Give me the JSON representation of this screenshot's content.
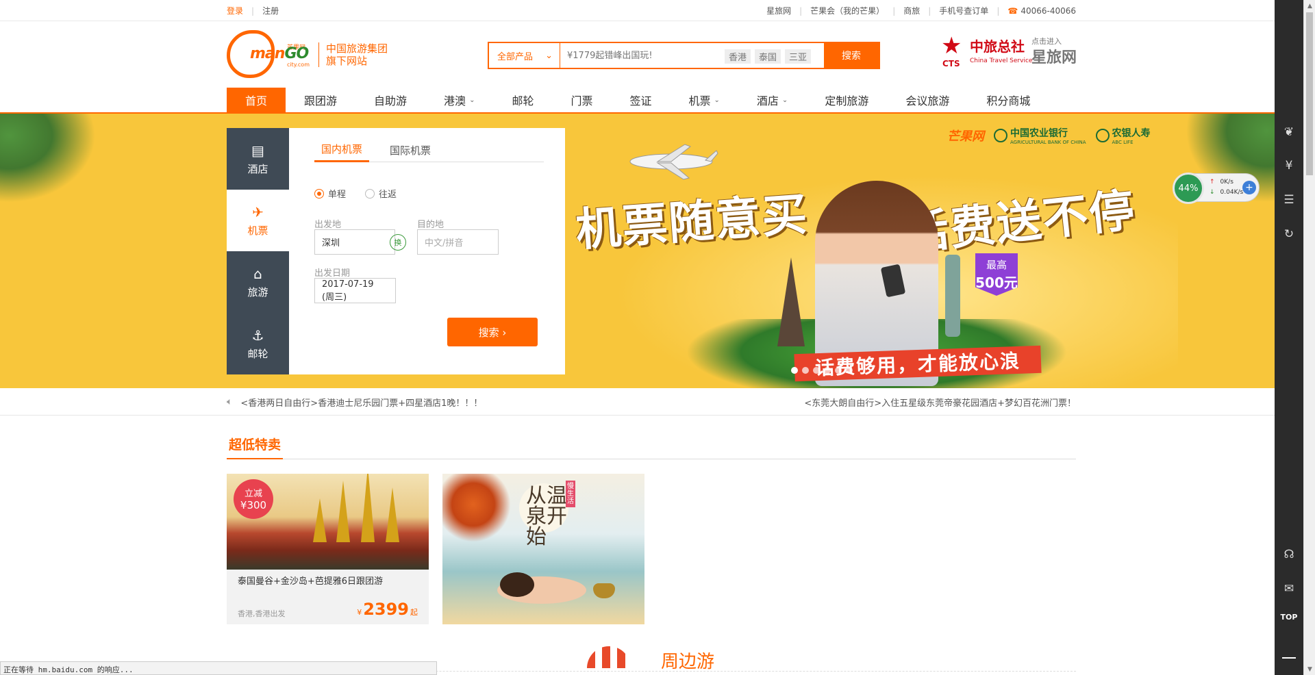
{
  "topbar": {
    "login": "登录",
    "register": "注册",
    "links": [
      "星旅网",
      "芒果会（我的芒果）",
      "商旅",
      "手机号查订单"
    ],
    "phone": "40066-40066"
  },
  "header": {
    "logo_cn": "芒果网",
    "logo_en_a": "man",
    "logo_en_b": "GO",
    "logo_sub": "city.com",
    "slogan_line1": "中国旅游集团",
    "slogan_line2": "旗下网站",
    "search": {
      "category": "全部产品",
      "placeholder": "¥1779起错峰出国玩!",
      "hot": [
        "香港",
        "泰国",
        "三亚"
      ],
      "button": "搜索"
    },
    "cts": {
      "cn": "中旅总社",
      "abbr": "CTS",
      "en": "China Travel Service",
      "enter": "点击进入",
      "site": "星旅网"
    }
  },
  "nav": {
    "items": [
      {
        "label": "首页",
        "active": true,
        "caret": false
      },
      {
        "label": "跟团游",
        "active": false,
        "caret": false
      },
      {
        "label": "自助游",
        "active": false,
        "caret": false
      },
      {
        "label": "港澳",
        "active": false,
        "caret": true
      },
      {
        "label": "邮轮",
        "active": false,
        "caret": false
      },
      {
        "label": "门票",
        "active": false,
        "caret": false
      },
      {
        "label": "签证",
        "active": false,
        "caret": false
      },
      {
        "label": "机票",
        "active": false,
        "caret": true
      },
      {
        "label": "酒店",
        "active": false,
        "caret": true
      },
      {
        "label": "定制旅游",
        "active": false,
        "caret": false
      },
      {
        "label": "会议旅游",
        "active": false,
        "caret": false
      },
      {
        "label": "积分商城",
        "active": false,
        "caret": false
      }
    ]
  },
  "booking": {
    "tabs": [
      {
        "label": "酒店",
        "icon": "hotel-icon"
      },
      {
        "label": "机票",
        "icon": "plane-icon"
      },
      {
        "label": "旅游",
        "icon": "bag-icon"
      },
      {
        "label": "邮轮",
        "icon": "anchor-icon"
      }
    ],
    "subtabs": [
      "国内机票",
      "国际机票"
    ],
    "trip_types": [
      "单程",
      "往返"
    ],
    "from_label": "出发地",
    "from_value": "深圳",
    "to_label": "目的地",
    "to_placeholder": "中文/拼音",
    "swap": "换",
    "date_label": "出发日期",
    "date_value": "2017-07-19 (周三)",
    "search_button": "搜索 ›"
  },
  "banner": {
    "headline_left": "机票随意买",
    "headline_right": "话费送不停",
    "badge_line1": "最高",
    "badge_line2": "500元",
    "ribbon": "话费够用，才能放心浪",
    "partner_mango": "芒果网",
    "partner_bank": "中国农业银行",
    "partner_bank_en": "AGRICULTURAL BANK OF CHINA",
    "partner_life": "农银人寿",
    "partner_life_en": "ABC LIFE"
  },
  "net_widget": {
    "percent": "44%",
    "up": "0K/s",
    "down": "0.04K/s",
    "add": "+"
  },
  "notice": {
    "left": "<香港两日自由行>香港迪士尼乐园门票+四星酒店1晚！！！",
    "right": "<东莞大朗自由行>入住五星级东莞帝豪花园酒店+梦幻百花洲门票！"
  },
  "section_title": "超低特卖",
  "cards": [
    {
      "promo_a": "立减",
      "promo_b": "¥300",
      "title": "泰国曼谷+金沙岛+芭提雅6日跟团游",
      "from": "香港,香港出发",
      "currency": "¥",
      "price": "2399",
      "suffix": "起"
    },
    {
      "title": "从温泉开始",
      "tag": "慢生活"
    }
  ],
  "peek_title": "周边游",
  "status_bar": "正在等待 hm.baidu.com 的响应...",
  "rail": {
    "top_label": "TOP",
    "icons": [
      "leaf-icon",
      "yen-icon",
      "note-icon",
      "refresh-icon",
      "headset-icon",
      "chat-icon"
    ]
  },
  "colors": {
    "brand": "#ff6600",
    "banner_bg": "#f8c63b",
    "panel_tab": "#3f4a55",
    "rail": "#2b2b2b"
  }
}
